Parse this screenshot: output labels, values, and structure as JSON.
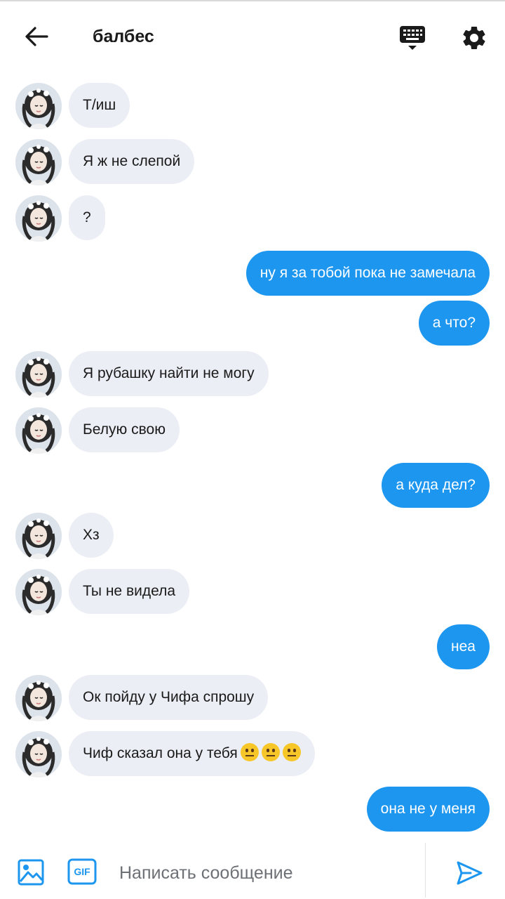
{
  "header": {
    "title": "балбес",
    "back_icon": "arrow-left-icon",
    "keyboard_icon": "keyboard-icon",
    "settings_icon": "gear-icon"
  },
  "messages": [
    {
      "side": "in",
      "text": "Т/иш"
    },
    {
      "side": "in",
      "text": "Я ж не слепой"
    },
    {
      "side": "in",
      "text": "?"
    },
    {
      "side": "out",
      "text": "ну я за тобой пока не замечала"
    },
    {
      "side": "out",
      "text": "а что?"
    },
    {
      "side": "in",
      "text": "Я рубашку найти не могу"
    },
    {
      "side": "in",
      "text": "Белую свою"
    },
    {
      "side": "out",
      "text": "а куда дел?"
    },
    {
      "side": "in",
      "text": "Хз"
    },
    {
      "side": "in",
      "text": "Ты не видела"
    },
    {
      "side": "out",
      "text": "неа"
    },
    {
      "side": "in",
      "text": "Ок пойду у Чифа спрошу"
    },
    {
      "side": "in",
      "text": "Чиф сказал она у тебя",
      "emoji": [
        "😐",
        "😐",
        "😐"
      ]
    },
    {
      "side": "out",
      "text": "она не у меня"
    }
  ],
  "composer": {
    "placeholder": "Написать сообщение",
    "gif_label": "GIF",
    "image_icon": "image-icon",
    "send_icon": "send-icon"
  },
  "colors": {
    "outgoing_bubble": "#1d96f0",
    "incoming_bubble": "#eceef5",
    "accent": "#1d96f0"
  }
}
